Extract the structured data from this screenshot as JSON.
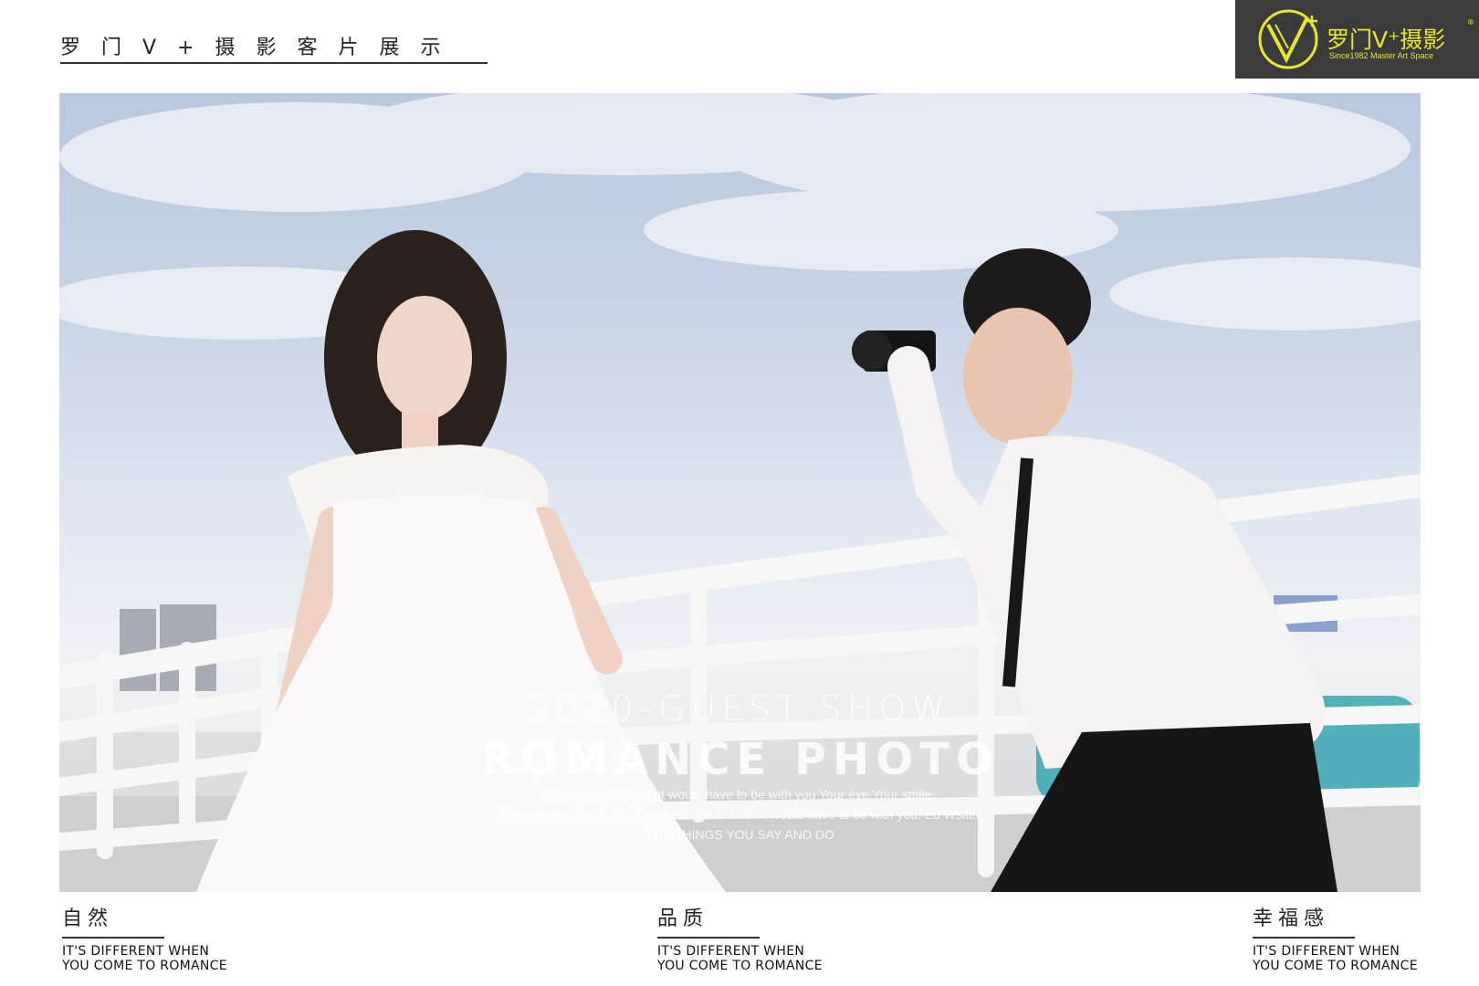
{
  "header": {
    "title": "罗门V+摄影客片展示"
  },
  "logo": {
    "name": "罗门V⁺摄影",
    "tagline": "Since1982  Master Art Space",
    "registered": "®",
    "color": "#e8e533"
  },
  "photo": {
    "overlay_year": "2020-GUEST SHOW",
    "overlay_title": "ROMANCE PHOTO",
    "overlay_lines": [
      "If I were fall in love. It would have to be with you Your eye,Your smile.",
      "The way you laugh. So,if I were to fall in love. It would have to be with you. Ed Wslter",
      "THE THINGS YOU SAY AND DO"
    ]
  },
  "captions": [
    {
      "title": "自然",
      "line1": "IT'S DIFFERENT WHEN",
      "line2": "YOU COME TO ROMANCE"
    },
    {
      "title": "品质",
      "line1": "IT'S DIFFERENT WHEN",
      "line2": "YOU COME TO ROMANCE"
    },
    {
      "title": "幸福感",
      "line1": "IT'S DIFFERENT WHEN",
      "line2": "YOU COME TO ROMANCE"
    }
  ]
}
